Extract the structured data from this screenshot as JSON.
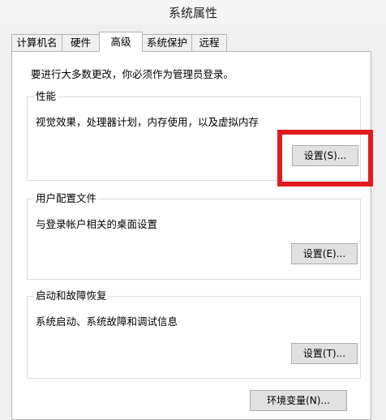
{
  "window": {
    "title": "系统属性"
  },
  "tabs": [
    {
      "label": "计算机名",
      "active": false
    },
    {
      "label": "硬件",
      "active": false
    },
    {
      "label": "高级",
      "active": true
    },
    {
      "label": "系统保护",
      "active": false
    },
    {
      "label": "远程",
      "active": false
    }
  ],
  "advanced": {
    "admin_notice": "要进行大多数更改，你必须作为管理员登录。",
    "performance": {
      "title": "性能",
      "description": "视觉效果，处理器计划，内存使用，以及虚拟内存",
      "button": "设置(S)..."
    },
    "user_profiles": {
      "title": "用户配置文件",
      "description": "与登录帐户相关的桌面设置",
      "button": "设置(E)..."
    },
    "startup_recovery": {
      "title": "启动和故障恢复",
      "description": "系统启动、系统故障和调试信息",
      "button": "设置(T)..."
    },
    "env_button": "环境变量(N)..."
  },
  "colors": {
    "highlight": "#e01b1b",
    "window_bg": "#f0f0f0",
    "panel_bg": "#ffffff",
    "button_bg": "#e1e1e1"
  }
}
